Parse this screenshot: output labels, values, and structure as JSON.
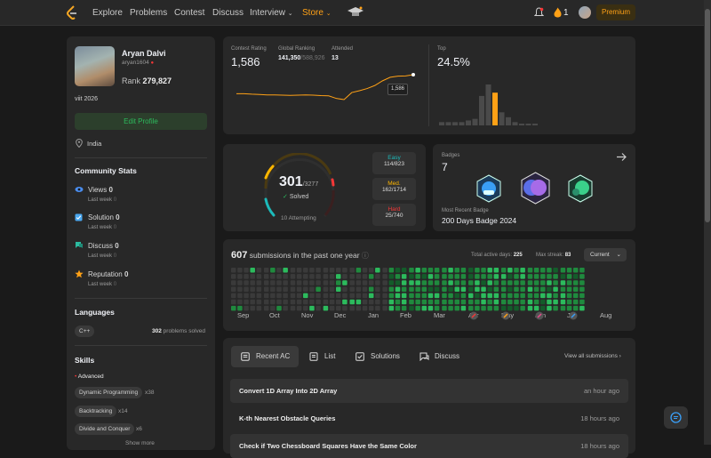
{
  "nav": {
    "items": [
      "Explore",
      "Problems",
      "Contest",
      "Discuss"
    ],
    "interview": "Interview",
    "store": "Store",
    "streak": "1",
    "premium": "Premium"
  },
  "profile": {
    "name": "Aryan Dalvi",
    "username": "aryan1604",
    "rank_label": "Rank",
    "rank": "279,827",
    "school": "viit 2026",
    "edit": "Edit Profile",
    "location": "India"
  },
  "community": {
    "title": "Community Stats",
    "items": [
      {
        "label": "Views",
        "value": "0",
        "sub": "Last week",
        "subval": "0"
      },
      {
        "label": "Solution",
        "value": "0",
        "sub": "Last week",
        "subval": "0"
      },
      {
        "label": "Discuss",
        "value": "0",
        "sub": "Last week",
        "subval": "0"
      },
      {
        "label": "Reputation",
        "value": "0",
        "sub": "Last week",
        "subval": "0"
      }
    ]
  },
  "languages": {
    "title": "Languages",
    "lang": "C++",
    "count": "302",
    "suffix": "problems solved"
  },
  "skills": {
    "title": "Skills",
    "level": "Advanced",
    "items": [
      {
        "name": "Dynamic Programming",
        "count": "x38"
      },
      {
        "name": "Backtracking",
        "count": "x14"
      },
      {
        "name": "Divide and Conquer",
        "count": "x6"
      }
    ],
    "more": "Show more"
  },
  "contest": {
    "rating_label": "Contest Rating",
    "rating": "1,586",
    "global_label": "Global Ranking",
    "global": "141,350",
    "global_total": "/588,926",
    "attended_label": "Attended",
    "attended": "13",
    "tooltip": "1,586",
    "top_label": "Top",
    "top": "24.5%",
    "rating_history": [
      1505,
      1505,
      1503,
      1502,
      1500,
      1500,
      1499,
      1498,
      1499,
      1500,
      1499,
      1497,
      1496,
      1485,
      1480,
      1510,
      1518,
      1527,
      1540,
      1560,
      1575,
      1580,
      1581,
      1586
    ],
    "histogram": [
      2,
      2,
      2,
      2,
      3,
      4,
      18,
      25,
      20,
      8,
      5,
      2,
      1,
      1,
      1
    ],
    "highlight_index": 8
  },
  "solved": {
    "count": "301",
    "total": "/3277",
    "label": "Solved",
    "attempting": "10 Attempting",
    "easy_label": "Easy",
    "easy": "114/823",
    "med_label": "Med.",
    "med": "162/1714",
    "hard_label": "Hard",
    "hard": "25/740",
    "easy_color": "#1cbaba",
    "med_color": "#ffb700",
    "hard_color": "#f63737"
  },
  "badges": {
    "label": "Badges",
    "count": "7",
    "recent_label": "Most Recent Badge",
    "recent": "200 Days Badge 2024"
  },
  "calendar": {
    "count": "607",
    "title": "submissions in the past one year",
    "active_label": "Total active days:",
    "active": "225",
    "streak_label": "Max streak:",
    "streak": "83",
    "select": "Current",
    "months": [
      "Sep",
      "Oct",
      "Nov",
      "Dec",
      "Jan",
      "Feb",
      "Mar",
      "Apr",
      "May",
      "Jun",
      "Jul",
      "Aug"
    ]
  },
  "tabs": {
    "recent": "Recent AC",
    "list": "List",
    "solutions": "Solutions",
    "discuss": "Discuss",
    "view_all": "View all submissions"
  },
  "submissions": [
    {
      "title": "Convert 1D Array Into 2D Array",
      "time": "an hour ago"
    },
    {
      "title": "K-th Nearest Obstacle Queries",
      "time": "18 hours ago"
    },
    {
      "title": "Check if Two Chessboard Squares Have the Same Color",
      "time": "18 hours ago"
    }
  ]
}
